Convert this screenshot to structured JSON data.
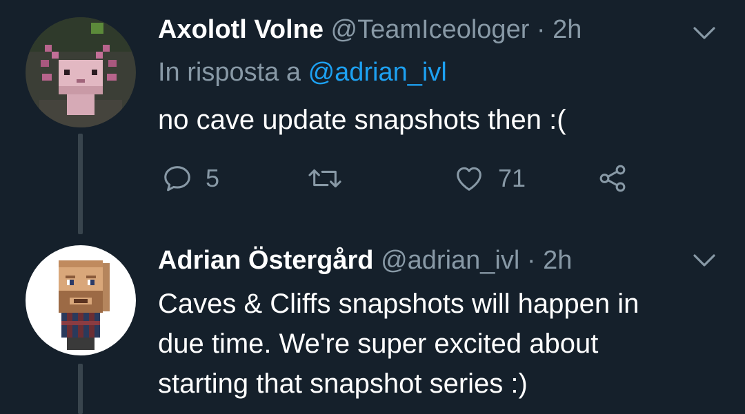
{
  "tweets": [
    {
      "display_name": "Axolotl Volne",
      "handle": "@TeamIceologer",
      "separator": " · ",
      "time": "2h",
      "reply_prefix": "In risposta a ",
      "reply_to": "@adrian_ivl",
      "text": "no cave update snapshots then :(",
      "actions": {
        "reply_count": "5",
        "retweet_count": "",
        "like_count": "71"
      },
      "avatar_icon": "axolotl-avatar-icon"
    },
    {
      "display_name": "Adrian Östergård",
      "handle": "@adrian_ivl",
      "separator": " · ",
      "time": "2h",
      "text_lines": [
        "Caves & Cliffs snapshots will happen in",
        "due time. We're super excited about",
        "starting that snapshot series :)"
      ],
      "avatar_icon": "minecraft-character-avatar-icon"
    }
  ],
  "colors": {
    "background": "#15202b",
    "text": "#ffffff",
    "muted": "#8899a6",
    "link": "#1da1f2",
    "thread_line": "#38444d"
  }
}
